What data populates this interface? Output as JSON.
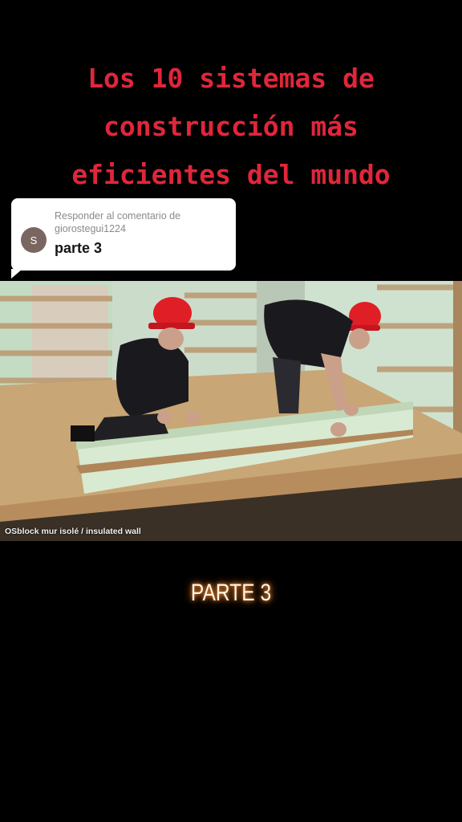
{
  "title": {
    "line1": "Los 10 sistemas de",
    "line2": "construcción más",
    "line3": "eficientes del mundo"
  },
  "reply": {
    "avatar_letter": "S",
    "label": "Responder al comentario de",
    "username": "giorostegui1224",
    "text": "parte 3"
  },
  "video": {
    "watermark": "OSblock mur isolé / insulated wall"
  },
  "caption": {
    "text": "PARTE 3"
  },
  "colors": {
    "title": "#e0263a",
    "caption_glow": "#ff9a3c",
    "background": "#000000"
  }
}
